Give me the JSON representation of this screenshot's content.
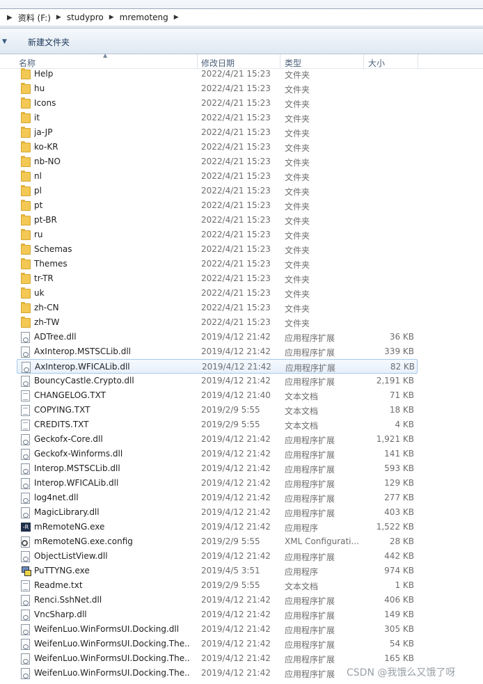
{
  "breadcrumb": {
    "items": [
      "资料 (F:)",
      "studypro",
      "mremoteng"
    ]
  },
  "toolbar": {
    "new_folder_label": "新建文件夹"
  },
  "columns": {
    "name": "名称",
    "modified": "修改日期",
    "type": "类型",
    "size": "大小"
  },
  "files": [
    {
      "name": "Help",
      "date": "2022/4/21 15:23",
      "type": "文件夹",
      "size": "",
      "icon": "folder-icon"
    },
    {
      "name": "hu",
      "date": "2022/4/21 15:23",
      "type": "文件夹",
      "size": "",
      "icon": "folder-icon"
    },
    {
      "name": "Icons",
      "date": "2022/4/21 15:23",
      "type": "文件夹",
      "size": "",
      "icon": "folder-icon"
    },
    {
      "name": "it",
      "date": "2022/4/21 15:23",
      "type": "文件夹",
      "size": "",
      "icon": "folder-icon"
    },
    {
      "name": "ja-JP",
      "date": "2022/4/21 15:23",
      "type": "文件夹",
      "size": "",
      "icon": "folder-icon"
    },
    {
      "name": "ko-KR",
      "date": "2022/4/21 15:23",
      "type": "文件夹",
      "size": "",
      "icon": "folder-icon"
    },
    {
      "name": "nb-NO",
      "date": "2022/4/21 15:23",
      "type": "文件夹",
      "size": "",
      "icon": "folder-icon"
    },
    {
      "name": "nl",
      "date": "2022/4/21 15:23",
      "type": "文件夹",
      "size": "",
      "icon": "folder-icon"
    },
    {
      "name": "pl",
      "date": "2022/4/21 15:23",
      "type": "文件夹",
      "size": "",
      "icon": "folder-icon"
    },
    {
      "name": "pt",
      "date": "2022/4/21 15:23",
      "type": "文件夹",
      "size": "",
      "icon": "folder-icon"
    },
    {
      "name": "pt-BR",
      "date": "2022/4/21 15:23",
      "type": "文件夹",
      "size": "",
      "icon": "folder-icon"
    },
    {
      "name": "ru",
      "date": "2022/4/21 15:23",
      "type": "文件夹",
      "size": "",
      "icon": "folder-icon"
    },
    {
      "name": "Schemas",
      "date": "2022/4/21 15:23",
      "type": "文件夹",
      "size": "",
      "icon": "folder-icon"
    },
    {
      "name": "Themes",
      "date": "2022/4/21 15:23",
      "type": "文件夹",
      "size": "",
      "icon": "folder-icon"
    },
    {
      "name": "tr-TR",
      "date": "2022/4/21 15:23",
      "type": "文件夹",
      "size": "",
      "icon": "folder-icon"
    },
    {
      "name": "uk",
      "date": "2022/4/21 15:23",
      "type": "文件夹",
      "size": "",
      "icon": "folder-icon"
    },
    {
      "name": "zh-CN",
      "date": "2022/4/21 15:23",
      "type": "文件夹",
      "size": "",
      "icon": "folder-icon"
    },
    {
      "name": "zh-TW",
      "date": "2022/4/21 15:23",
      "type": "文件夹",
      "size": "",
      "icon": "folder-icon"
    },
    {
      "name": "ADTree.dll",
      "date": "2019/4/12 21:42",
      "type": "应用程序扩展",
      "size": "36 KB",
      "icon": "dll-icon"
    },
    {
      "name": "AxInterop.MSTSCLib.dll",
      "date": "2019/4/12 21:42",
      "type": "应用程序扩展",
      "size": "339 KB",
      "icon": "dll-icon"
    },
    {
      "name": "AxInterop.WFICALib.dll",
      "date": "2019/4/12 21:42",
      "type": "应用程序扩展",
      "size": "82 KB",
      "icon": "dll-icon",
      "selected": true
    },
    {
      "name": "BouncyCastle.Crypto.dll",
      "date": "2019/4/12 21:42",
      "type": "应用程序扩展",
      "size": "2,191 KB",
      "icon": "dll-icon"
    },
    {
      "name": "CHANGELOG.TXT",
      "date": "2019/4/12 21:40",
      "type": "文本文档",
      "size": "71 KB",
      "icon": "text-file-icon"
    },
    {
      "name": "COPYING.TXT",
      "date": "2019/2/9 5:55",
      "type": "文本文档",
      "size": "18 KB",
      "icon": "text-file-icon"
    },
    {
      "name": "CREDITS.TXT",
      "date": "2019/2/9 5:55",
      "type": "文本文档",
      "size": "4 KB",
      "icon": "text-file-icon"
    },
    {
      "name": "Geckofx-Core.dll",
      "date": "2019/4/12 21:42",
      "type": "应用程序扩展",
      "size": "1,921 KB",
      "icon": "dll-icon"
    },
    {
      "name": "Geckofx-Winforms.dll",
      "date": "2019/4/12 21:42",
      "type": "应用程序扩展",
      "size": "141 KB",
      "icon": "dll-icon"
    },
    {
      "name": "Interop.MSTSCLib.dll",
      "date": "2019/4/12 21:42",
      "type": "应用程序扩展",
      "size": "593 KB",
      "icon": "dll-icon"
    },
    {
      "name": "Interop.WFICALib.dll",
      "date": "2019/4/12 21:42",
      "type": "应用程序扩展",
      "size": "129 KB",
      "icon": "dll-icon"
    },
    {
      "name": "log4net.dll",
      "date": "2019/4/12 21:42",
      "type": "应用程序扩展",
      "size": "277 KB",
      "icon": "dll-icon"
    },
    {
      "name": "MagicLibrary.dll",
      "date": "2019/4/12 21:42",
      "type": "应用程序扩展",
      "size": "403 KB",
      "icon": "dll-icon"
    },
    {
      "name": "mRemoteNG.exe",
      "date": "2019/4/12 21:42",
      "type": "应用程序",
      "size": "1,522 KB",
      "icon": "mremoteng-app-icon"
    },
    {
      "name": "mRemoteNG.exe.config",
      "date": "2019/2/9 5:55",
      "type": "XML Configurati...",
      "size": "28 KB",
      "icon": "config-file-icon"
    },
    {
      "name": "ObjectListView.dll",
      "date": "2019/4/12 21:42",
      "type": "应用程序扩展",
      "size": "442 KB",
      "icon": "dll-icon"
    },
    {
      "name": "PuTTYNG.exe",
      "date": "2019/4/5 3:51",
      "type": "应用程序",
      "size": "974 KB",
      "icon": "putty-app-icon"
    },
    {
      "name": "Readme.txt",
      "date": "2019/2/9 5:55",
      "type": "文本文档",
      "size": "1 KB",
      "icon": "text-file-icon"
    },
    {
      "name": "Renci.SshNet.dll",
      "date": "2019/4/12 21:42",
      "type": "应用程序扩展",
      "size": "406 KB",
      "icon": "dll-icon"
    },
    {
      "name": "VncSharp.dll",
      "date": "2019/4/12 21:42",
      "type": "应用程序扩展",
      "size": "149 KB",
      "icon": "dll-icon"
    },
    {
      "name": "WeifenLuo.WinFormsUI.Docking.dll",
      "date": "2019/4/12 21:42",
      "type": "应用程序扩展",
      "size": "305 KB",
      "icon": "dll-icon"
    },
    {
      "name": "WeifenLuo.WinFormsUI.Docking.The...",
      "date": "2019/4/12 21:42",
      "type": "应用程序扩展",
      "size": "54 KB",
      "icon": "dll-icon"
    },
    {
      "name": "WeifenLuo.WinFormsUI.Docking.The...",
      "date": "2019/4/12 21:42",
      "type": "应用程序扩展",
      "size": "165 KB",
      "icon": "dll-icon"
    },
    {
      "name": "WeifenLuo.WinFormsUI.Docking.The...",
      "date": "2019/4/12 21:42",
      "type": "应用程序扩展",
      "size": "",
      "icon": "dll-icon"
    }
  ],
  "watermark": "CSDN @我饿么又饿了呀"
}
